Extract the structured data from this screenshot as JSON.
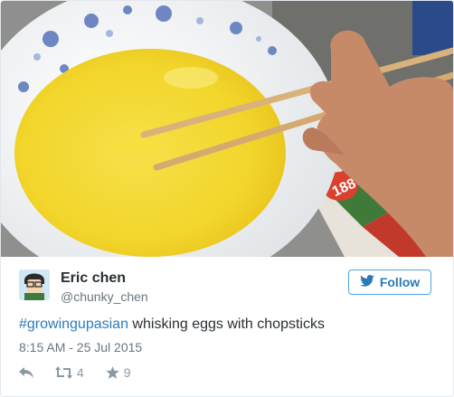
{
  "photo": {
    "subject": "bowl-of-beaten-eggs-with-chopsticks",
    "colors": {
      "egg": "#f2d62b",
      "bowl": "#f4f6f6",
      "pattern": "#6e86c2",
      "chopstick": "#d9b27a",
      "skin": "#c68a69"
    },
    "package_text": "188"
  },
  "user": {
    "name": "Eric chen",
    "handle": "@chunky_chen"
  },
  "follow": {
    "label": "Follow",
    "icon": "twitter-bird-icon",
    "color": "#2b7bb9"
  },
  "tweet": {
    "hashtag": "#growingupasian",
    "text": " whisking eggs with chopsticks",
    "timestamp": "8:15 AM - 25 Jul 2015"
  },
  "actions": {
    "reply": {
      "icon": "reply-icon"
    },
    "retweet": {
      "icon": "retweet-icon",
      "count": "4"
    },
    "like": {
      "icon": "star-icon",
      "count": "9"
    }
  }
}
